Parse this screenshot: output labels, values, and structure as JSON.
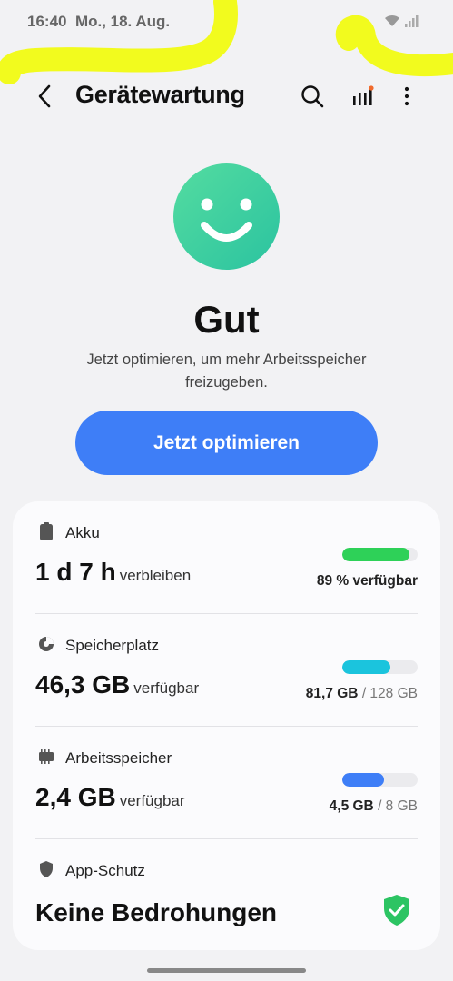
{
  "status_bar": {
    "time": "16:40",
    "date": "Mo., 18. Aug."
  },
  "header": {
    "title": "Gerätewartung"
  },
  "status": {
    "headline": "Gut",
    "description": "Jetzt optimieren, um mehr Arbeitsspeicher freizugeben."
  },
  "optimize_button": {
    "label": "Jetzt optimieren"
  },
  "battery": {
    "label": "Akku",
    "value": "1 d 7 h",
    "unit": "verbleiben",
    "usage": "89 % verfügbar",
    "fill_percent": 89,
    "color": "#2ed158"
  },
  "storage": {
    "label": "Speicherplatz",
    "value": "46,3 GB",
    "unit": "verfügbar",
    "used": "81,7 GB",
    "total": "/ 128 GB",
    "fill_percent": 64,
    "color": "#1bc4dd"
  },
  "memory": {
    "label": "Arbeitsspeicher",
    "value": "2,4 GB",
    "unit": "verfügbar",
    "used": "4,5 GB",
    "total": "/ 8 GB",
    "fill_percent": 56,
    "color": "#3e7ef7"
  },
  "app_protection": {
    "label": "App-Schutz",
    "value": "Keine Bedrohungen",
    "color": "#2cc463"
  },
  "accent_color": "#3e7ef7"
}
